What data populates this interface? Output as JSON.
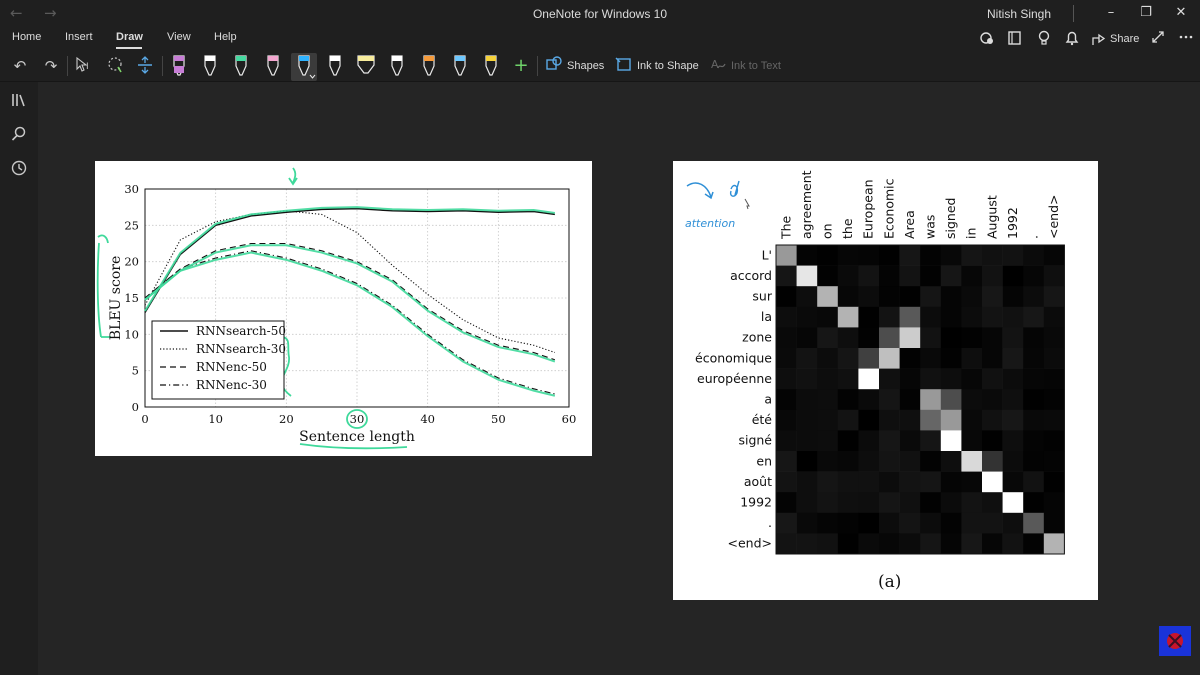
{
  "titlebar": {
    "title": "OneNote for Windows 10",
    "user": "Nitish Singh",
    "back_icon": "arrow-left-icon",
    "forward_icon": "arrow-right-icon"
  },
  "menu": {
    "items": [
      "Home",
      "Insert",
      "Draw",
      "View",
      "Help"
    ],
    "active": "Draw"
  },
  "header_actions": {
    "share_label": "Share"
  },
  "ribbon": {
    "shapes_label": "Shapes",
    "ink_to_shape_label": "Ink to Shape",
    "ink_to_text_label": "Ink to Text",
    "pen_colors": [
      "#c77dd6",
      "#ffffff",
      "#46d9a0",
      "#f3a6cf",
      "#2fb3ff",
      "#ffffff",
      "#f7ec9c",
      "#ffffff",
      "#f59b3b",
      "#6ec8ff",
      "#f5d23a"
    ],
    "add_pen_label": "+"
  },
  "bleu_chart": {
    "ylabel": "BLEU score",
    "xlabel": "Sentence length",
    "legend": [
      "RNNsearch-50",
      "RNNsearch-30",
      "RNNenc-50",
      "RNNenc-30"
    ],
    "xticks": [
      "0",
      "10",
      "20",
      "30",
      "40",
      "50",
      "60"
    ],
    "yticks": [
      "0",
      "5",
      "10",
      "15",
      "20",
      "25",
      "30"
    ]
  },
  "attention": {
    "source_words": [
      "The",
      "agreement",
      "on",
      "the",
      "European",
      "Economic",
      "Area",
      "was",
      "signed",
      "in",
      "August",
      "1992",
      ".",
      "<end>"
    ],
    "target_words": [
      "L'",
      "accord",
      "sur",
      "la",
      "zone",
      "économique",
      "européenne",
      "a",
      "été",
      "signé",
      "en",
      "août",
      "1992",
      ".",
      "<end>"
    ],
    "caption": "(a)",
    "annotation": "attention"
  },
  "chart_data": [
    {
      "type": "line",
      "title": "",
      "xlabel": "Sentence length",
      "ylabel": "BLEU score",
      "xlim": [
        0,
        60
      ],
      "ylim": [
        0,
        30
      ],
      "grid": true,
      "legend_position": "bottom-left",
      "x": [
        0,
        5,
        10,
        15,
        20,
        25,
        30,
        35,
        40,
        45,
        50,
        55,
        58
      ],
      "series": [
        {
          "name": "RNNsearch-50",
          "style": "solid",
          "values": [
            13,
            21,
            25,
            26.3,
            26.8,
            27.2,
            27.3,
            27,
            26.9,
            27,
            26.8,
            26.9,
            26.5
          ]
        },
        {
          "name": "RNNsearch-30",
          "style": "dotted",
          "values": [
            14,
            23,
            25.5,
            26.5,
            27,
            26.5,
            24,
            19.5,
            15.5,
            12,
            9.5,
            8.5,
            7.5
          ]
        },
        {
          "name": "RNNenc-50",
          "style": "dashed",
          "values": [
            15,
            19,
            21.5,
            22.5,
            22.5,
            21.5,
            20,
            17.5,
            13.5,
            10.5,
            8.5,
            7.5,
            6.5
          ]
        },
        {
          "name": "RNNenc-30",
          "style": "dash-dot",
          "values": [
            15,
            19,
            20.5,
            21.5,
            20.5,
            19,
            17,
            14,
            10,
            6.5,
            4,
            2.5,
            1.8
          ]
        }
      ]
    },
    {
      "type": "heatmap",
      "caption": "(a)",
      "x_labels": [
        "The",
        "agreement",
        "on",
        "the",
        "European",
        "Economic",
        "Area",
        "was",
        "signed",
        "in",
        "August",
        "1992",
        ".",
        "<end>"
      ],
      "y_labels": [
        "L'",
        "accord",
        "sur",
        "la",
        "zone",
        "économique",
        "européenne",
        "a",
        "été",
        "signé",
        "en",
        "août",
        "1992",
        ".",
        "<end>"
      ],
      "highlights": [
        {
          "row": 0,
          "col": 0,
          "value": 0.6
        },
        {
          "row": 1,
          "col": 1,
          "value": 0.9
        },
        {
          "row": 2,
          "col": 2,
          "value": 0.7
        },
        {
          "row": 3,
          "col": 3,
          "value": 0.7
        },
        {
          "row": 3,
          "col": 6,
          "value": 0.35
        },
        {
          "row": 4,
          "col": 5,
          "value": 0.3
        },
        {
          "row": 4,
          "col": 6,
          "value": 0.8
        },
        {
          "row": 5,
          "col": 4,
          "value": 0.25
        },
        {
          "row": 5,
          "col": 5,
          "value": 0.75
        },
        {
          "row": 6,
          "col": 4,
          "value": 1.0
        },
        {
          "row": 7,
          "col": 7,
          "value": 0.6
        },
        {
          "row": 7,
          "col": 8,
          "value": 0.3
        },
        {
          "row": 8,
          "col": 7,
          "value": 0.4
        },
        {
          "row": 8,
          "col": 8,
          "value": 0.6
        },
        {
          "row": 9,
          "col": 8,
          "value": 1.0
        },
        {
          "row": 10,
          "col": 9,
          "value": 0.85
        },
        {
          "row": 10,
          "col": 10,
          "value": 0.2
        },
        {
          "row": 11,
          "col": 10,
          "value": 1.0
        },
        {
          "row": 12,
          "col": 11,
          "value": 1.0
        },
        {
          "row": 13,
          "col": 12,
          "value": 0.35
        },
        {
          "row": 14,
          "col": 13,
          "value": 0.7
        }
      ]
    }
  ]
}
